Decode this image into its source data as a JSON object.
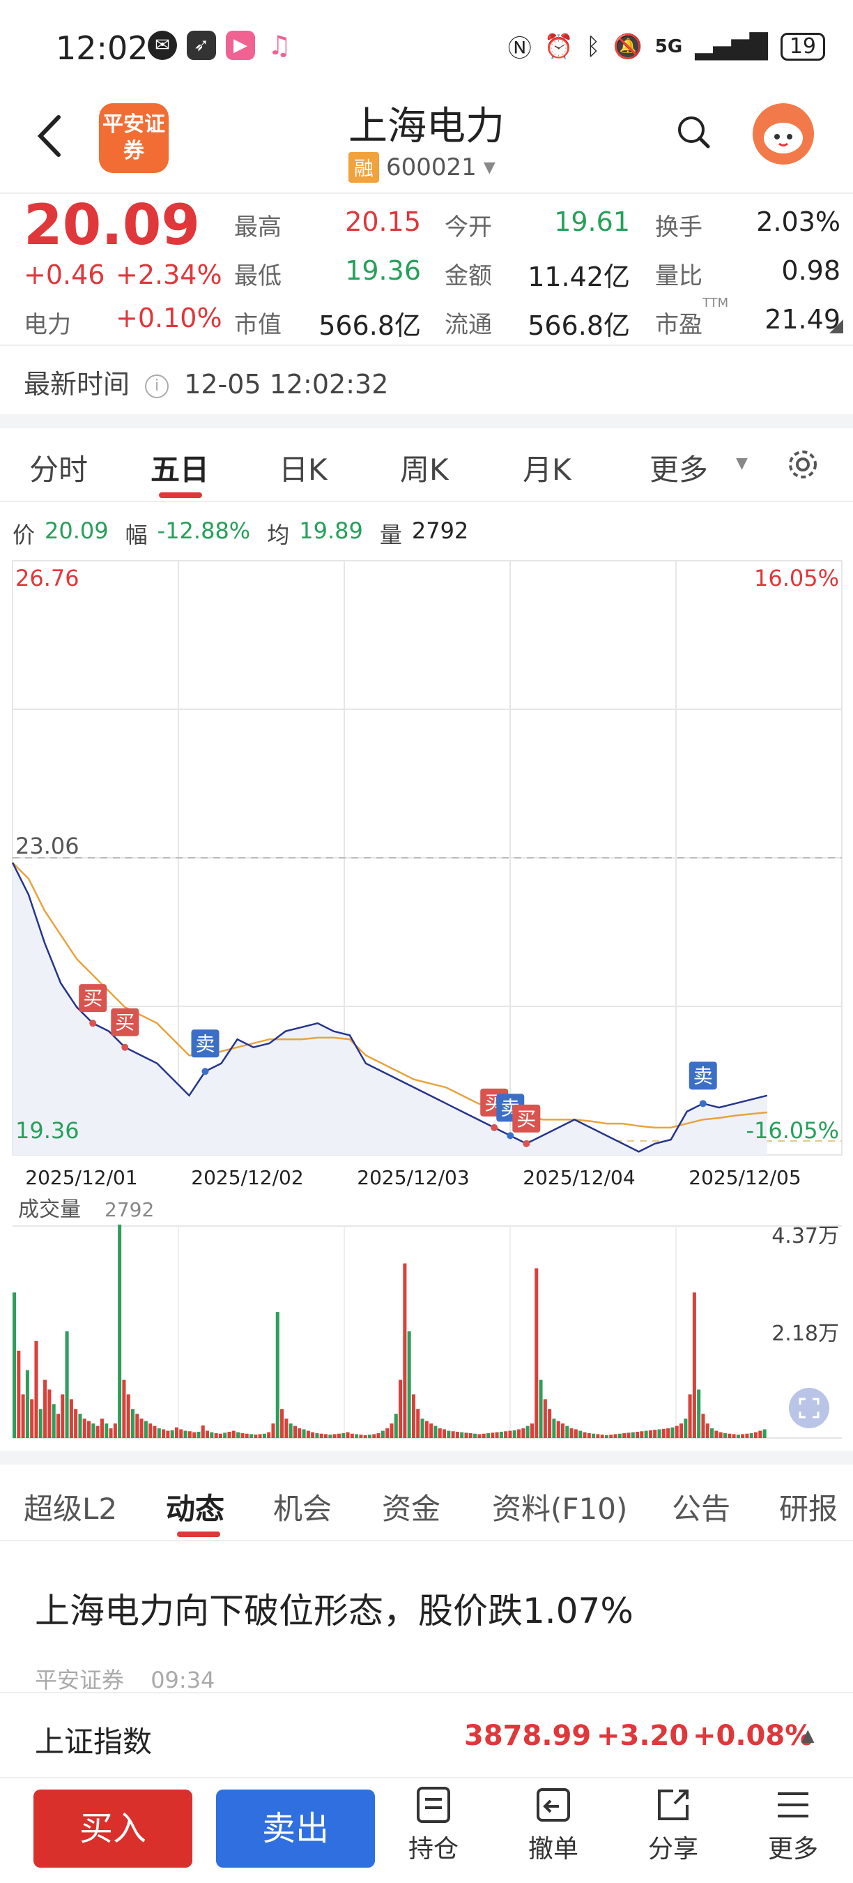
{
  "status_bar": {
    "time": "12:02",
    "network": "5G",
    "battery": "19"
  },
  "header": {
    "brand": "平安证券",
    "stock_name": "上海电力",
    "margin_tag": "融",
    "code": "600021"
  },
  "quote": {
    "price": "20.09",
    "change": "+0.46",
    "change_pct": "+2.34%",
    "sector_name": "电力",
    "sector_pct": "+0.10%",
    "rows": [
      [
        {
          "label": "最高",
          "value": "20.15",
          "color": "#e0373a"
        },
        {
          "label": "今开",
          "value": "19.61",
          "color": "#26a05a"
        },
        {
          "label": "换手",
          "value": "2.03%",
          "color": "#222"
        }
      ],
      [
        {
          "label": "最低",
          "value": "19.36",
          "color": "#26a05a"
        },
        {
          "label": "金额",
          "value": "11.42亿",
          "color": "#222"
        },
        {
          "label": "量比",
          "value": "0.98",
          "color": "#222"
        }
      ],
      [
        {
          "label": "市值",
          "value": "566.8亿",
          "color": "#222"
        },
        {
          "label": "流通",
          "value": "566.8亿",
          "color": "#222"
        },
        {
          "label": "市盈",
          "value": "21.49",
          "color": "#222",
          "sup": "TTM"
        }
      ]
    ]
  },
  "latest_time": {
    "label": "最新时间",
    "value": "12-05 12:02:32"
  },
  "chart_tabs": [
    "分时",
    "五日",
    "日K",
    "周K",
    "月K",
    "更多"
  ],
  "active_chart_tab": 1,
  "info_line": {
    "price_label": "价",
    "price": "20.09",
    "range_label": "幅",
    "range": "-12.88%",
    "avg_label": "均",
    "avg": "19.89",
    "vol_label": "量",
    "vol": "2792"
  },
  "chart_data": {
    "type": "line",
    "y_top_label": "26.76",
    "y_top_pct": "16.05%",
    "y_mid_label": "23.06",
    "y_bottom_label": "19.36",
    "y_bottom_pct": "-16.05%",
    "ylim": [
      19.36,
      26.76
    ],
    "x_labels": [
      "2025/12/01",
      "2025/12/02",
      "2025/12/03",
      "2025/12/04",
      "2025/12/05"
    ],
    "series": [
      {
        "values": [
          23.0,
          22.6,
          22.0,
          21.5,
          21.2,
          21.0,
          20.9,
          20.7,
          20.6,
          20.5,
          20.3,
          20.1,
          20.4,
          20.5,
          20.8,
          20.7,
          20.75,
          20.9,
          20.95,
          21.0,
          20.9,
          20.85,
          20.5,
          20.4,
          20.3,
          20.2,
          20.1,
          20.0,
          19.9,
          19.8,
          19.7,
          19.6,
          19.5,
          19.6,
          19.7,
          19.8,
          19.7,
          19.6,
          19.5,
          19.4,
          19.5,
          19.55,
          19.9,
          20.0,
          19.95,
          20.0,
          20.05,
          20.1
        ]
      },
      {
        "values": [
          23.0,
          22.8,
          22.4,
          22.1,
          21.8,
          21.6,
          21.4,
          21.2,
          21.1,
          21.0,
          20.8,
          20.6,
          20.6,
          20.65,
          20.7,
          20.75,
          20.8,
          20.8,
          20.8,
          20.82,
          20.82,
          20.8,
          20.6,
          20.5,
          20.4,
          20.3,
          20.25,
          20.2,
          20.1,
          20.0,
          19.95,
          19.9,
          19.85,
          19.8,
          19.8,
          19.8,
          19.78,
          19.75,
          19.75,
          19.72,
          19.7,
          19.7,
          19.75,
          19.8,
          19.82,
          19.85,
          19.87,
          19.89
        ]
      }
    ],
    "markers": [
      {
        "text": "买",
        "type": "buy"
      },
      {
        "text": "买",
        "type": "buy"
      },
      {
        "text": "卖",
        "type": "sell"
      },
      {
        "text": "买",
        "type": "buy"
      },
      {
        "text": "卖",
        "type": "sell"
      },
      {
        "text": "买",
        "type": "buy"
      },
      {
        "text": "卖",
        "type": "sell"
      }
    ],
    "volume": {
      "label": "成交量",
      "value": "2792",
      "max_label": "4.37万",
      "mid_label": "2.18万",
      "ylim": [
        0,
        43700
      ],
      "bars": [
        30000,
        18000,
        9000,
        14000,
        8000,
        20000,
        6000,
        12000,
        10000,
        7000,
        5000,
        9000,
        22000,
        8000,
        6000,
        5000,
        4000,
        3500,
        3000,
        2500,
        4000,
        3000,
        2000,
        3000,
        44000,
        12000,
        9000,
        6000,
        5000,
        4000,
        3500,
        3000,
        2500,
        2000,
        1800,
        1500,
        1600,
        2200,
        1800,
        1500,
        1400,
        1200,
        1300,
        2600,
        1500,
        1200,
        1000,
        900,
        1100,
        1300,
        1500,
        1200,
        1000,
        900,
        800,
        700,
        800,
        900,
        1200,
        3000,
        26000,
        6000,
        4000,
        3000,
        2500,
        2000,
        1800,
        1500,
        1200,
        1000,
        900,
        800,
        700,
        800,
        900,
        1000,
        1200,
        900,
        800,
        700,
        600,
        700,
        800,
        1000,
        1500,
        2000,
        3000,
        5000,
        12000,
        36000,
        22000,
        9000,
        6000,
        4000,
        3500,
        3000,
        2500,
        2000,
        1800,
        1500,
        1400,
        1300,
        1200,
        1100,
        1000,
        900,
        800,
        900,
        1000,
        1100,
        1200,
        1300,
        1400,
        1500,
        1600,
        1800,
        2000,
        2500,
        3000,
        35000,
        12000,
        8000,
        6000,
        4000,
        3500,
        3000,
        2500,
        2000,
        1800,
        1500,
        1200,
        1000,
        900,
        800,
        700,
        600,
        700,
        800,
        900,
        1000,
        1100,
        1200,
        1300,
        1400,
        1500,
        1600,
        1700,
        1800,
        1900,
        2000,
        2200,
        2500,
        3000,
        4000,
        9000,
        30000,
        10000,
        5000,
        3000,
        2000,
        1500,
        1200,
        1000,
        900,
        800,
        700,
        800,
        900,
        1000,
        1200,
        1500,
        1800
      ]
    }
  },
  "feature_tabs": [
    "超级L2",
    "动态",
    "机会",
    "资金",
    "资料(F10)",
    "公告",
    "研报"
  ],
  "active_feature_tab": 1,
  "news": {
    "title": "上海电力向下破位形态，股价跌1.07%",
    "source": "平安证券",
    "time": "09:34"
  },
  "index_bar": {
    "name": "上证指数",
    "value": "3878.99",
    "change": "+3.20",
    "pct": "+0.08%"
  },
  "bottom": {
    "buy": "买入",
    "sell": "卖出",
    "nav": [
      "持仓",
      "撤单",
      "分享",
      "更多"
    ]
  },
  "colors": {
    "up": "#e0373a",
    "down": "#26a05a",
    "brand": "#f26d34",
    "sell_btn": "#2f6fe0"
  }
}
